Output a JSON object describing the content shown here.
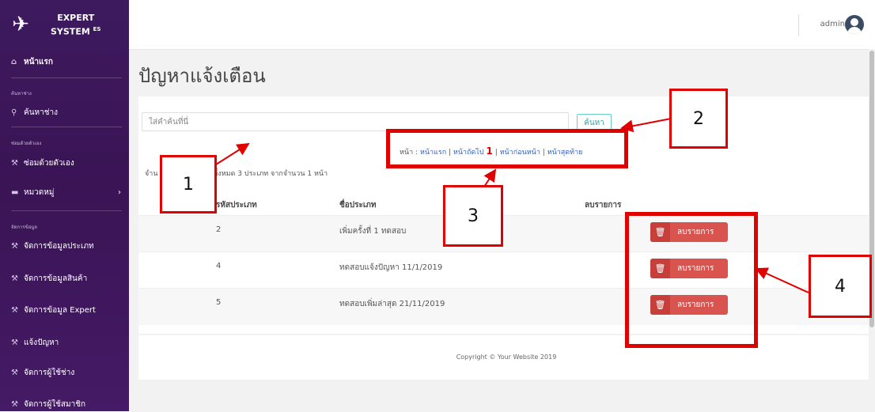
{
  "brand": {
    "line1": "EXPERT",
    "line2": "SYSTEM",
    "sup": "ES"
  },
  "sidebar": {
    "home": "หน้าแรก",
    "sec_search": "ค้นหาช่าง",
    "search_item": "ค้นหาช่าง",
    "sec_self": "ซ่อมด้วยตัวเอง",
    "self_item": "ซ่อมด้วยตัวเอง",
    "category": "หมวดหมู่",
    "sec_manage": "จัดการข้อมูล",
    "items": [
      "จัดการข้อมูลประเภท",
      "จัดการข้อมูลสินค้า",
      "จัดการข้อมูล Expert",
      "แจ้งปัญหา",
      "จัดการผู้ใช้ช่าง",
      "จัดการผู้ใช้สมาชิก"
    ]
  },
  "topbar": {
    "user": "admin"
  },
  "page_title": "ปัญหาแจ้งเตือน",
  "search": {
    "placeholder": "ใส่คำค้นที่นี่",
    "button": "ค้นหา"
  },
  "pager": {
    "prefix": "หน้า :",
    "first": "หน้าแรก",
    "next": "หน้าถัดไป",
    "current": "1",
    "prev": "หน้าก่อนหน้า",
    "last": "หน้าสุดท้าย"
  },
  "info": {
    "left": "จำน",
    "right": "นทั้งหมด 3 ประเภท จากจำนวน 1 หน้า"
  },
  "table": {
    "headers": [
      "รหัสประเภท",
      "ชื่อประเภท",
      "ลบรายการ"
    ],
    "rows": [
      {
        "id": "2",
        "name": "เพิ่มครั้งที่ 1 ทดสอบ",
        "action": "ลบรายการ"
      },
      {
        "id": "4",
        "name": "ทดสอบแจ้งปัญหา 11/1/2019",
        "action": "ลบรายการ"
      },
      {
        "id": "5",
        "name": "ทดสอบเพิ่มล่าสุด 21/11/2019",
        "action": "ลบรายการ"
      }
    ]
  },
  "footer": "Copyright © Your Website 2019",
  "annotations": [
    "1",
    "2",
    "3",
    "4"
  ],
  "colors": {
    "sidebar": "#3d1a5e",
    "danger": "#d9534f",
    "annotation": "#e00000"
  }
}
